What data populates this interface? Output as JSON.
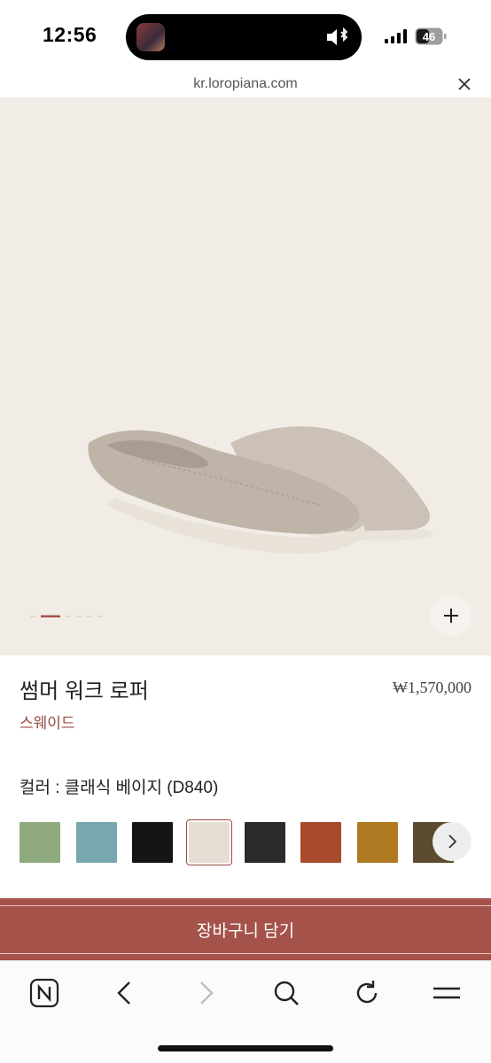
{
  "status_bar": {
    "time": "12:56",
    "battery": "46"
  },
  "browser": {
    "url": "kr.loropiana.com",
    "close_icon": "close-icon"
  },
  "gallery": {
    "image_count": 6,
    "active_index": 1,
    "zoom_icon": "plus-icon",
    "background_color": "#f1ede6"
  },
  "product": {
    "name": "썸머 워크 로퍼",
    "price": "₩1,570,000",
    "material": "스웨이드",
    "color_label": "컬러 : 클래식 베이지 (D840)"
  },
  "swatches": [
    {
      "name": "sage-green",
      "color": "#8faa7e",
      "selected": false
    },
    {
      "name": "light-blue",
      "color": "#79a7b0",
      "selected": false
    },
    {
      "name": "black",
      "color": "#151515",
      "selected": false
    },
    {
      "name": "classic-beige",
      "color": "#e6ddd4",
      "selected": true
    },
    {
      "name": "charcoal",
      "color": "#2a2a28",
      "selected": false
    },
    {
      "name": "rust",
      "color": "#a84a2c",
      "selected": false
    },
    {
      "name": "mustard",
      "color": "#b07a22",
      "selected": false
    },
    {
      "name": "brown",
      "color": "#5b4c2f",
      "selected": false
    }
  ],
  "cart": {
    "label": "장바구니 담기",
    "background": "#a5524a"
  },
  "toolbar": {
    "items": [
      "naver-icon",
      "back-icon",
      "forward-icon",
      "search-icon",
      "reload-icon",
      "menu-icon"
    ]
  }
}
